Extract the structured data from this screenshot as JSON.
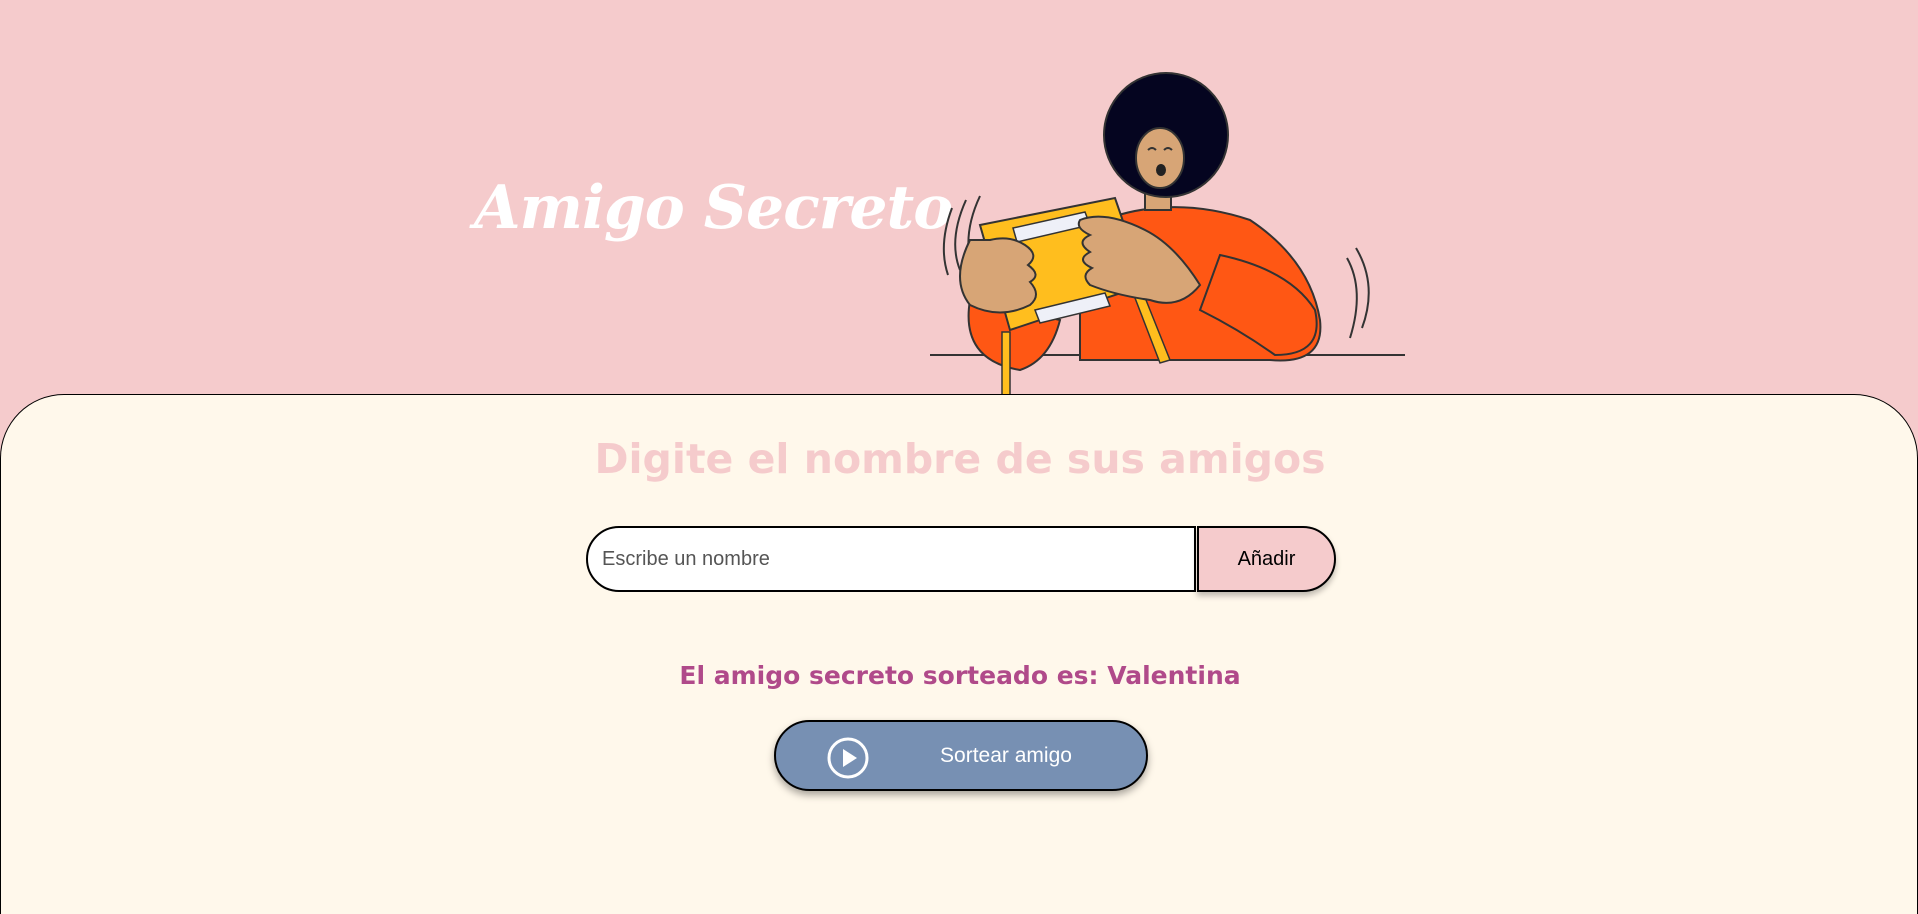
{
  "header": {
    "title": "Amigo Secreto"
  },
  "main": {
    "section_title": "Digite el nombre de sus amigos",
    "name_input": {
      "placeholder": "Escribe un nombre",
      "value": ""
    },
    "add_button_label": "Añadir",
    "result_text": "El amigo secreto sorteado es: Valentina",
    "draw_button": {
      "label": "Sortear amigo",
      "icon": "play-circle-icon"
    }
  },
  "colors": {
    "header_bg": "#f5cbcc",
    "main_bg": "#fff8eb",
    "section_title": "#f5cbcc",
    "result_text": "#b04a8a",
    "draw_button_bg": "#7790b3",
    "add_button_bg": "#f5cbcc"
  }
}
